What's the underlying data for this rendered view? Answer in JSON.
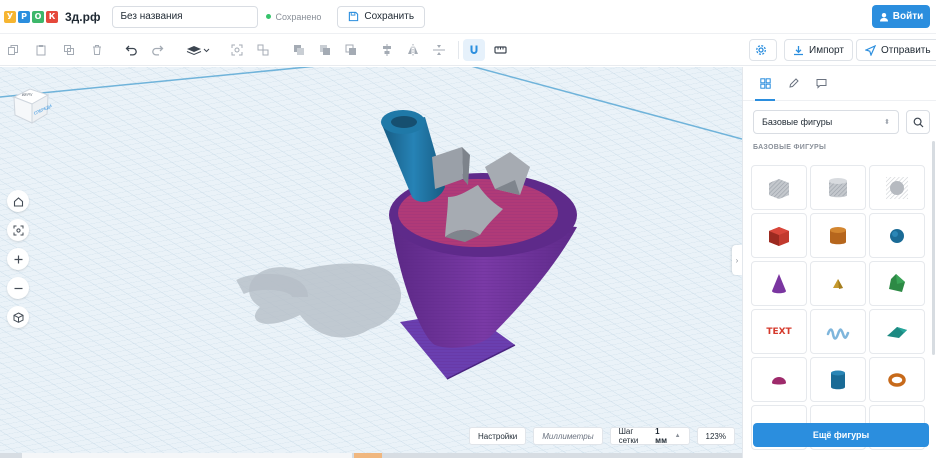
{
  "header": {
    "logo_letters": [
      "У",
      "Р",
      "О",
      "К"
    ],
    "logo_colors": [
      "#f6b531",
      "#2b8ede",
      "#3db76a",
      "#e5483b"
    ],
    "brand": "3д.рф",
    "project_name": "Без названия",
    "saved_status": "Сохранено",
    "save_button": "Сохранить",
    "login_button": "Войти"
  },
  "toolbar": {
    "icons_left": [
      "copy-icon",
      "paste-icon",
      "duplicate-icon",
      "delete-icon",
      "undo-icon",
      "redo-icon",
      "workplane-icon",
      "group-icon",
      "ungroup-icon",
      "solid-icon",
      "hole-icon",
      "combine-icon",
      "align-icon",
      "mirror-icon",
      "distribute-icon",
      "magnet-icon",
      "ruler-icon"
    ],
    "settings_icon": "gear-icon",
    "import_button": "Импорт",
    "send_button": "Отправить"
  },
  "viewport": {
    "view_cube": {
      "top": "ВЕРХ",
      "front": "СПЕРЕДИ"
    },
    "nav_buttons": [
      "home-icon",
      "fit-icon",
      "zoom-in-icon",
      "zoom-out-icon",
      "perspective-icon"
    ],
    "bottom": {
      "settings": "Настройки",
      "units": "Миллиметры",
      "grid_step_label": "Шаг сетки",
      "grid_step_value": "1 мм",
      "zoom": "123%"
    }
  },
  "panel": {
    "tabs": [
      "shapes-tab",
      "edit-tab",
      "comments-tab"
    ],
    "category": "Базовые фигуры",
    "section_title": "БАЗОВЫЕ ФИГУРЫ",
    "shapes": [
      {
        "name": "box-hole"
      },
      {
        "name": "cylinder-hole"
      },
      {
        "name": "sphere-hole"
      },
      {
        "name": "box"
      },
      {
        "name": "cylinder"
      },
      {
        "name": "sphere"
      },
      {
        "name": "cone"
      },
      {
        "name": "pyramid"
      },
      {
        "name": "polyhedron"
      },
      {
        "name": "text",
        "label": "TEXT"
      },
      {
        "name": "squiggle"
      },
      {
        "name": "wedge"
      },
      {
        "name": "half-sphere"
      },
      {
        "name": "tube"
      },
      {
        "name": "torus"
      },
      {
        "name": "empty-1"
      },
      {
        "name": "empty-2"
      },
      {
        "name": "empty-3"
      }
    ],
    "more_button": "Ещё фигуры"
  },
  "colors": {
    "accent": "#2b8ede",
    "cone_purple": "#6a2b8f",
    "base_plate": "#6a3fb0",
    "top_surface": "#b03a78",
    "cube_grey": "#a6abb2",
    "tube_blue": "#1c6c99"
  }
}
